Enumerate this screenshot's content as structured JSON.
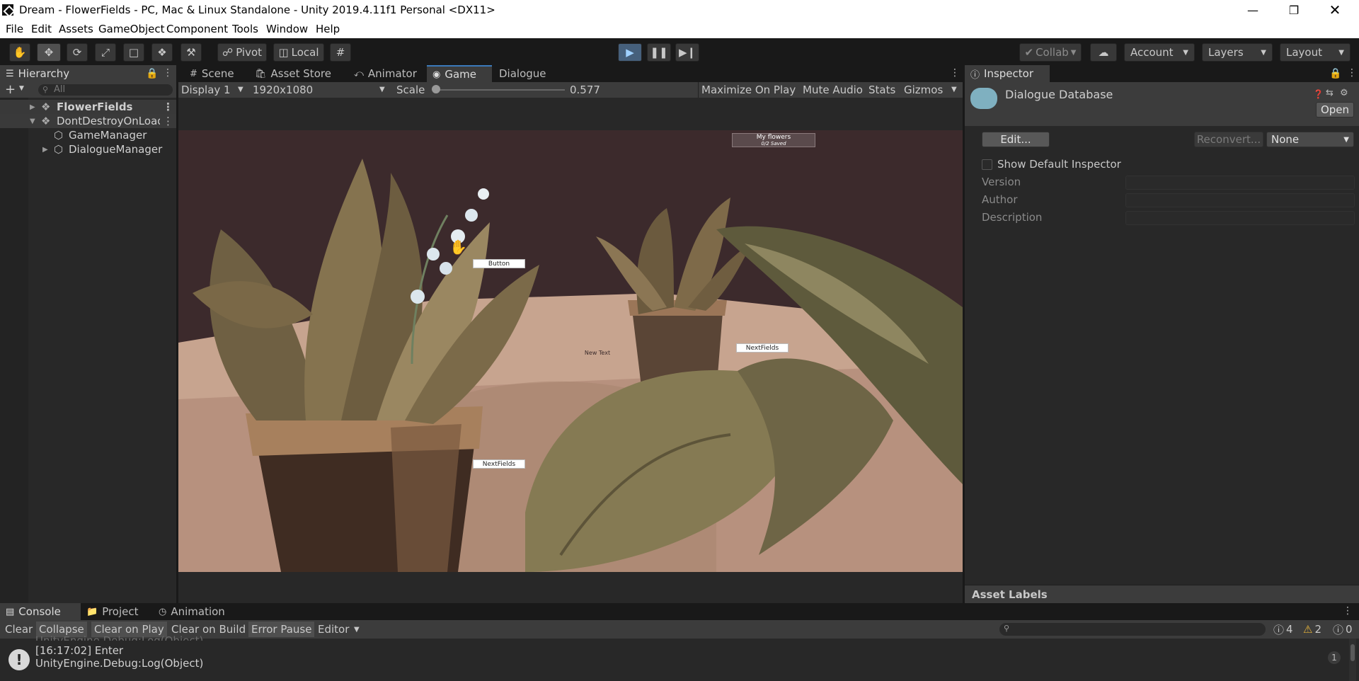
{
  "window": {
    "title": "Dream - FlowerFields - PC, Mac & Linux Standalone - Unity 2019.4.11f1 Personal <DX11>"
  },
  "menu": [
    "File",
    "Edit",
    "Assets",
    "GameObject",
    "Component",
    "Tools",
    "Window",
    "Help"
  ],
  "toolbar": {
    "pivot": "Pivot",
    "local": "Local",
    "collab": "Collab",
    "account": "Account",
    "layers": "Layers",
    "layout": "Layout"
  },
  "hierarchy": {
    "tab": "Hierarchy",
    "search_placeholder": "All",
    "items": [
      {
        "label": "FlowerFields"
      },
      {
        "label": "DontDestroyOnLoad"
      },
      {
        "label": "GameManager"
      },
      {
        "label": "DialogueManager"
      }
    ]
  },
  "scene_tabs": [
    "Scene",
    "Asset Store",
    "Animator",
    "Game",
    "Dialogue"
  ],
  "game": {
    "display": "Display 1",
    "resolution": "1920x1080",
    "scale_label": "Scale",
    "scale_value": "0.577",
    "maximize": "Maximize On Play",
    "mute": "Mute Audio",
    "stats": "Stats",
    "gizmos": "Gizmos",
    "my_flowers": "My flowers",
    "saved": "0/2 Saved",
    "button_label": "Button",
    "next_fields_1": "NextFields",
    "next_fields_2": "NextFields",
    "new_text": "New Text"
  },
  "inspector": {
    "tab": "Inspector",
    "asset_name": "Dialogue Database",
    "open": "Open",
    "edit": "Edit...",
    "reconvert": "Reconvert...",
    "none": "None",
    "show_default": "Show Default Inspector",
    "version": "Version",
    "author": "Author",
    "description": "Description",
    "asset_labels": "Asset Labels"
  },
  "console": {
    "tabs": [
      "Console",
      "Project",
      "Animation"
    ],
    "buttons": [
      "Clear",
      "Collapse",
      "Clear on Play",
      "Clear on Build",
      "Error Pause",
      "Editor"
    ],
    "log_count": "4",
    "warn_count": "2",
    "error_count": "0",
    "partial_line": "UnityEngine.Debug:Log(Object)",
    "entry_time_msg": "[16:17:02] Enter",
    "entry_detail": "UnityEngine.Debug:Log(Object)",
    "entry_count": "1"
  },
  "colors": {
    "accent_blue": "#3a79bb",
    "play_active": "#46607c",
    "panel_bg": "#282828",
    "toolbar_bg": "#3c3c3c"
  }
}
